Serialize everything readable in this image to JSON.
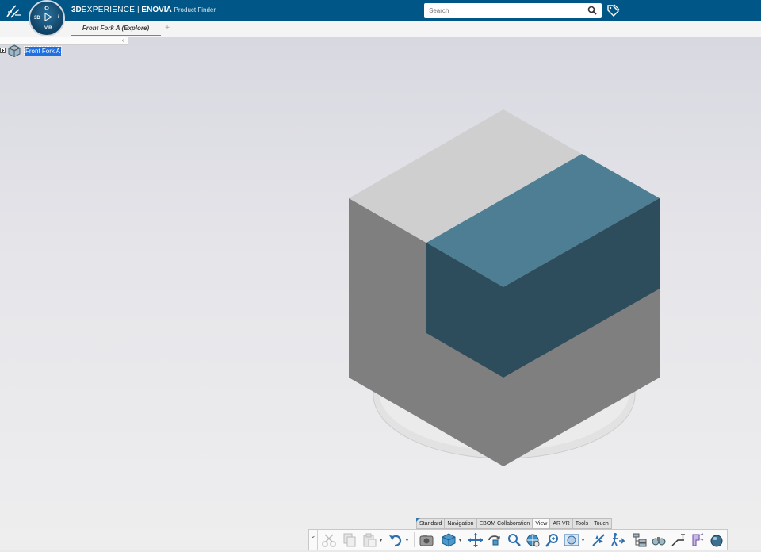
{
  "header": {
    "brand_3d": "3D",
    "brand_experience": "EXPERIENCE",
    "brand_sep": " | ",
    "brand_app": "ENOVIA",
    "brand_role": "Product Finder",
    "compass": {
      "top": "",
      "left": "3D",
      "right": "i",
      "bottom": "V,R"
    }
  },
  "search": {
    "placeholder": "Search",
    "value": ""
  },
  "tabs": [
    {
      "label": "Front Fork A (Explore)",
      "active": true
    }
  ],
  "tab_add_label": "+",
  "tree": {
    "collapse_label": "‹",
    "root_label": "Front Fork A"
  },
  "action_bar": {
    "tabs": [
      {
        "label": "Standard",
        "active": false
      },
      {
        "label": "Navigation",
        "active": false
      },
      {
        "label": "EBOM Collaboration",
        "active": false
      },
      {
        "label": "View",
        "active": true
      },
      {
        "label": "AR VR",
        "active": false
      },
      {
        "label": "Tools",
        "active": false
      },
      {
        "label": "Touch",
        "active": false
      }
    ],
    "expander_label": "⌄",
    "tools": [
      "cut-icon",
      "copy-icon",
      "paste-icon",
      "undo-icon",
      "capture-icon",
      "view-cube-icon",
      "pan-icon",
      "rotate-icon",
      "zoom-icon",
      "fit-all-icon",
      "zoom-area-icon",
      "render-style-icon",
      "fly-icon",
      "walk-icon",
      "tree-reorder-icon",
      "binoculars-icon",
      "measure-icon",
      "annotation-icon",
      "sphere-icon"
    ]
  },
  "colors": {
    "topbar": "#005686",
    "cube_top": "#cfcfcf",
    "cube_side": "#7f7f7f",
    "block_top": "#4d7e94",
    "block_side": "#2d4d5c",
    "tab_accent": "#4a90c6",
    "selection": "#1e6fe0"
  }
}
